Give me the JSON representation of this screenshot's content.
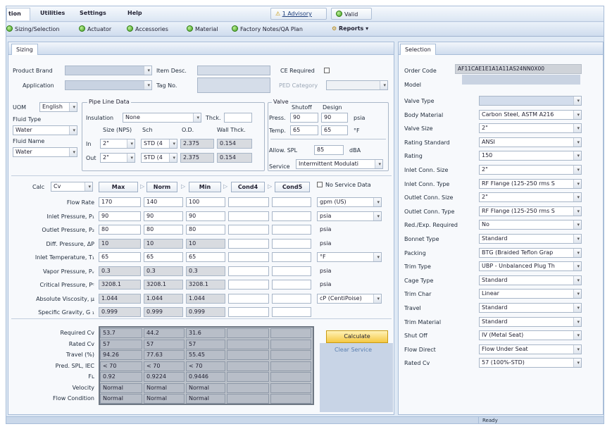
{
  "menu": {
    "items": [
      "tion",
      "Utilities",
      "Settings",
      "Help"
    ],
    "advisory": "1 Advisory",
    "valid": "Valid"
  },
  "toolbar": {
    "items": [
      "Sizing/Selection",
      "Actuator",
      "Accessories",
      "Material",
      "Factory Notes/QA Plan",
      "Reports"
    ]
  },
  "left_tab": "Sizing",
  "right_tab": "Selection",
  "header": {
    "product_brand": "Product Brand",
    "application": "Application",
    "item_desc": "Item Desc.",
    "tag_no": "Tag No.",
    "ce_required": "CE Required",
    "ped_category": "PED Category"
  },
  "uom": {
    "label": "UOM",
    "value": "English",
    "fluid_type_label": "Fluid Type",
    "fluid_type": "Water",
    "fluid_name_label": "Fluid Name",
    "fluid_name": "Water"
  },
  "pipe": {
    "title": "Pipe Line Data",
    "insulation_label": "Insulation",
    "insulation": "None",
    "thck": "Thck.",
    "size_hdr": "Size (NPS)",
    "sch_hdr": "Sch",
    "od_hdr": "O.D.",
    "wall_hdr": "Wall Thck.",
    "in_label": "In",
    "out_label": "Out",
    "in": {
      "size": "2\"",
      "sch": "STD (4",
      "od": "2.375",
      "wall": "0.154"
    },
    "out": {
      "size": "2\"",
      "sch": "STD (4",
      "od": "2.375",
      "wall": "0.154"
    }
  },
  "valve": {
    "title": "Valve",
    "shutoff": "Shutoff",
    "design": "Design",
    "press_label": "Press.",
    "press_shutoff": "90",
    "press_design": "90",
    "press_unit": "psia",
    "temp_label": "Temp.",
    "temp_shutoff": "65",
    "temp_design": "65",
    "temp_unit": "°F",
    "allow_spl_label": "Allow. SPL",
    "allow_spl": "85",
    "allow_spl_unit": "dBA",
    "service_label": "Service",
    "service": "Intermittent Modulati"
  },
  "calc": {
    "label": "Calc",
    "value": "Cv",
    "cols": [
      "Max",
      "Norm",
      "Min",
      "Cond4",
      "Cond5"
    ],
    "no_service": "No Service Data"
  },
  "process": {
    "rows": [
      {
        "label": "Flow Rate",
        "v": [
          "170",
          "140",
          "100",
          "",
          ""
        ],
        "unit": "gpm (US)",
        "unit_dd": true
      },
      {
        "label": "Inlet Pressure, P₁",
        "v": [
          "90",
          "90",
          "90",
          "",
          ""
        ],
        "unit": "psia",
        "unit_dd": true
      },
      {
        "label": "Outlet Pressure, P₂",
        "v": [
          "80",
          "80",
          "80",
          "",
          ""
        ],
        "unit": "psia",
        "unit_dd": false
      },
      {
        "label": "Diff. Pressure, ΔP",
        "v": [
          "10",
          "10",
          "10",
          "",
          ""
        ],
        "unit": "psia",
        "unit_dd": false
      },
      {
        "label": "Inlet Temperature, T₁",
        "v": [
          "65",
          "65",
          "65",
          "",
          ""
        ],
        "unit": "°F",
        "unit_dd": true
      },
      {
        "label": "Vapor Pressure, Pᵥ",
        "v": [
          "0.3",
          "0.3",
          "0.3",
          "",
          ""
        ],
        "unit": "psia",
        "unit_dd": false
      },
      {
        "label": "Critical Pressure, Pᶜ",
        "v": [
          "3208.1",
          "3208.1",
          "3208.1",
          "",
          ""
        ],
        "unit": "psia",
        "unit_dd": false
      },
      {
        "label": "Absolute Viscosity, μ",
        "v": [
          "1.044",
          "1.044",
          "1.044",
          "",
          ""
        ],
        "unit": "cP (CentiPoise)",
        "unit_dd": true
      },
      {
        "label": "Specific Gravity, G ₁",
        "v": [
          "0.999",
          "0.999",
          "0.999",
          "",
          ""
        ],
        "unit": "",
        "unit_dd": false
      }
    ]
  },
  "results": {
    "rows": [
      {
        "label": "Required Cv",
        "v": [
          "53.7",
          "44.2",
          "31.6"
        ]
      },
      {
        "label": "Rated Cv",
        "v": [
          "57",
          "57",
          "57"
        ]
      },
      {
        "label": "Travel (%)",
        "v": [
          "94.26",
          "77.63",
          "55.45"
        ]
      },
      {
        "label": "Pred. SPL, IEC",
        "v": [
          "< 70",
          "< 70",
          "< 70"
        ]
      },
      {
        "label": "Fʟ",
        "v": [
          "0.92",
          "0.9224",
          "0.9446"
        ]
      },
      {
        "label": "Velocity",
        "v": [
          "Normal",
          "Normal",
          "Normal"
        ]
      },
      {
        "label": "Flow Condition",
        "v": [
          "Normal",
          "Normal",
          "Normal"
        ]
      }
    ],
    "calculate": "Calculate",
    "clear": "Clear Service"
  },
  "selection": {
    "order_code_label": "Order Code",
    "order_code": "AF11CAE1E1A1A11AS24NN0X00",
    "model_label": "Model",
    "rows": [
      {
        "label": "Valve Type",
        "value": ""
      },
      {
        "label": "Body Material",
        "value": "Carbon Steel, ASTM A216"
      },
      {
        "label": "Valve Size",
        "value": "2\""
      },
      {
        "label": "Rating Standard",
        "value": "ANSI"
      },
      {
        "label": "Rating",
        "value": "150"
      },
      {
        "label": "Inlet Conn. Size",
        "value": "2\""
      },
      {
        "label": "Inlet Conn. Type",
        "value": "RF Flange (125-250 rms S"
      },
      {
        "label": "Outlet Conn. Size",
        "value": "2\""
      },
      {
        "label": "Outlet Conn. Type",
        "value": "RF Flange (125-250 rms S"
      },
      {
        "label": "Red./Exp. Required",
        "value": "No"
      },
      {
        "label": "Bonnet Type",
        "value": "Standard"
      },
      {
        "label": "Packing",
        "value": "BTG (Braided Teflon Grap"
      },
      {
        "label": "Trim Type",
        "value": "UBP - Unbalanced Plug Th"
      },
      {
        "label": "Cage Type",
        "value": "Standard"
      },
      {
        "label": "Trim Char",
        "value": "Linear"
      },
      {
        "label": "Travel",
        "value": "Standard"
      },
      {
        "label": "Trim Material",
        "value": "Standard"
      },
      {
        "label": "Shut Off",
        "value": "IV (Metal Seat)"
      },
      {
        "label": "Flow Direct",
        "value": "Flow Under Seat"
      },
      {
        "label": "Rated Cv",
        "value": "57 (100%-STD)"
      }
    ]
  },
  "status": {
    "text": "Ready"
  }
}
